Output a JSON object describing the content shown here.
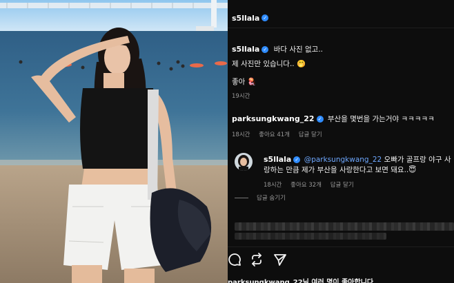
{
  "header": {
    "username": "s5llala"
  },
  "caption": {
    "username": "s5llala",
    "line1": "바다 사진 없고..",
    "line2": "제 사진만 있습니다..",
    "emoji": "🤭",
    "like_text": "좋아",
    "like_emoji": "🪼",
    "time": "19시간"
  },
  "comments": [
    {
      "username": "parksungkwang_22",
      "text": "부산을 몇번을 가는거야 ㅋㅋㅋㅋㅋ",
      "time": "18시간",
      "likes": "좋아요 41개",
      "reply": "답글 달기"
    }
  ],
  "reply": {
    "username": "s5llala",
    "mention": "@parksungkwang_22",
    "text_line1_rest": "오빠가 골프랑 야구 사",
    "text_line2": "랑하는 만큼 제가 부산을 사랑한다고 보면 돼요..",
    "emoji": "😇",
    "time": "18시간",
    "likes": "좋아요 32개",
    "reply": "답글 달기"
  },
  "hide_replies": "답글 숨기기",
  "likes_footer": "parksungkwang_22님 여러 명이 좋아합니다",
  "icons": [
    "verified-badge-icon",
    "comment-icon",
    "repost-icon",
    "share-icon"
  ],
  "colors": {
    "accent": "#2f8cff",
    "mention": "#6ea8ff",
    "bg": "#0d0d0d"
  }
}
